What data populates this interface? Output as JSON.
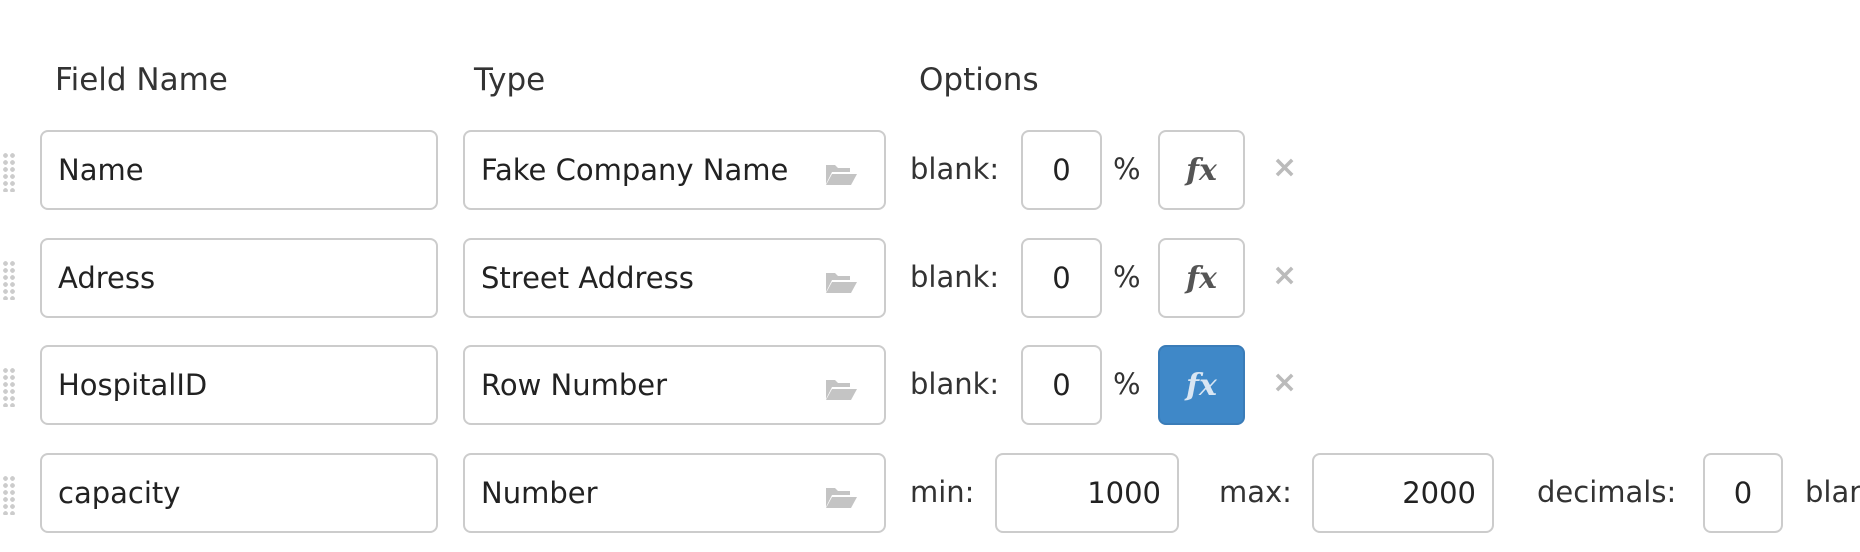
{
  "headers": {
    "field_name": "Field Name",
    "type": "Type",
    "options": "Options"
  },
  "rows": [
    {
      "name": "Name",
      "type": "Fake Company Name",
      "blank_label": "blank:",
      "blank": "0",
      "percent": "%",
      "fx": "fx",
      "fx_active": false,
      "remove": "×"
    },
    {
      "name": "Adress",
      "type": "Street Address",
      "blank_label": "blank:",
      "blank": "0",
      "percent": "%",
      "fx": "fx",
      "fx_active": false,
      "remove": "×"
    },
    {
      "name": "HospitalID",
      "type": "Row Number",
      "blank_label": "blank:",
      "blank": "0",
      "percent": "%",
      "fx": "fx",
      "fx_active": true,
      "remove": "×"
    },
    {
      "name": "capacity",
      "type": "Number",
      "min_label": "min:",
      "min": "1000",
      "max_label": "max:",
      "max": "2000",
      "decimals_label": "decimals:",
      "decimals": "0",
      "blank_label": "blank:"
    }
  ],
  "colors": {
    "accent": "#3f88c8",
    "border": "#cccccc"
  }
}
